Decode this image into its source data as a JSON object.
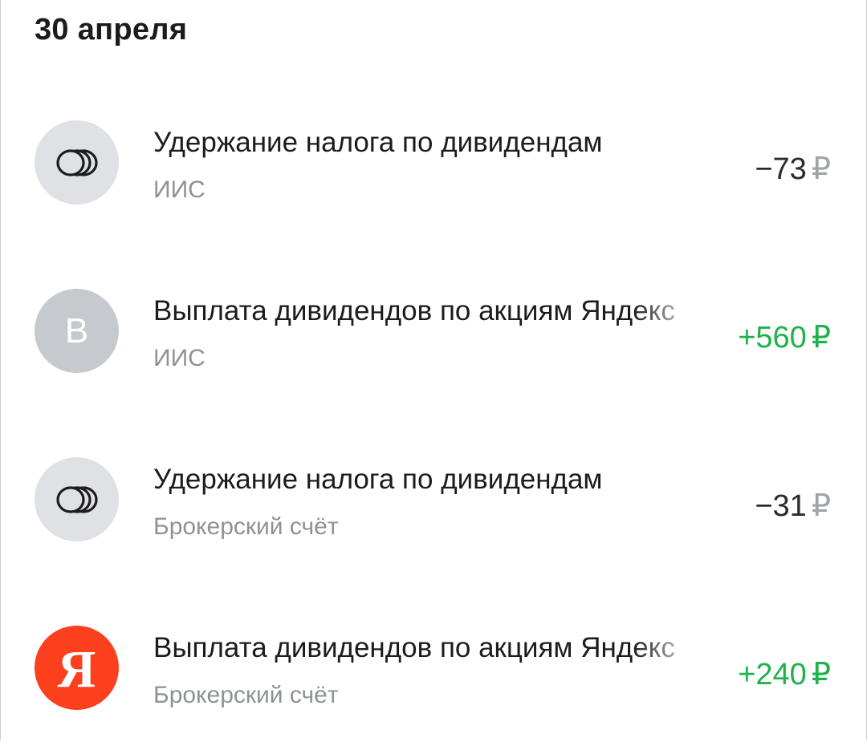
{
  "date_header": "30 апреля",
  "operations": [
    {
      "title": "Удержание налога по дивидендам",
      "account": "ИИС",
      "amount": "−73",
      "currency": "₽",
      "icon": "coins-icon",
      "sign": "negative"
    },
    {
      "title": "Выплата дивидендов по акциям Яндекс",
      "account": "ИИС",
      "amount": "+560",
      "currency": "₽",
      "icon_letter": "В",
      "sign": "positive"
    },
    {
      "title": "Удержание налога по дивидендам",
      "account": "Брокерский счёт",
      "amount": "−31",
      "currency": "₽",
      "icon": "coins-icon",
      "sign": "negative"
    },
    {
      "title": "Выплата дивидендов по акциям Яндекс",
      "account": "Брокерский счёт",
      "amount": "+240",
      "currency": "₽",
      "icon_letter": "Я",
      "icon": "yandex-logo",
      "sign": "positive"
    }
  ],
  "colors": {
    "positive": "#1fb14a",
    "negative": "#2b2b2e",
    "avatar_bg": "#dfe1e4",
    "yandex_red": "#fc3f1d"
  }
}
